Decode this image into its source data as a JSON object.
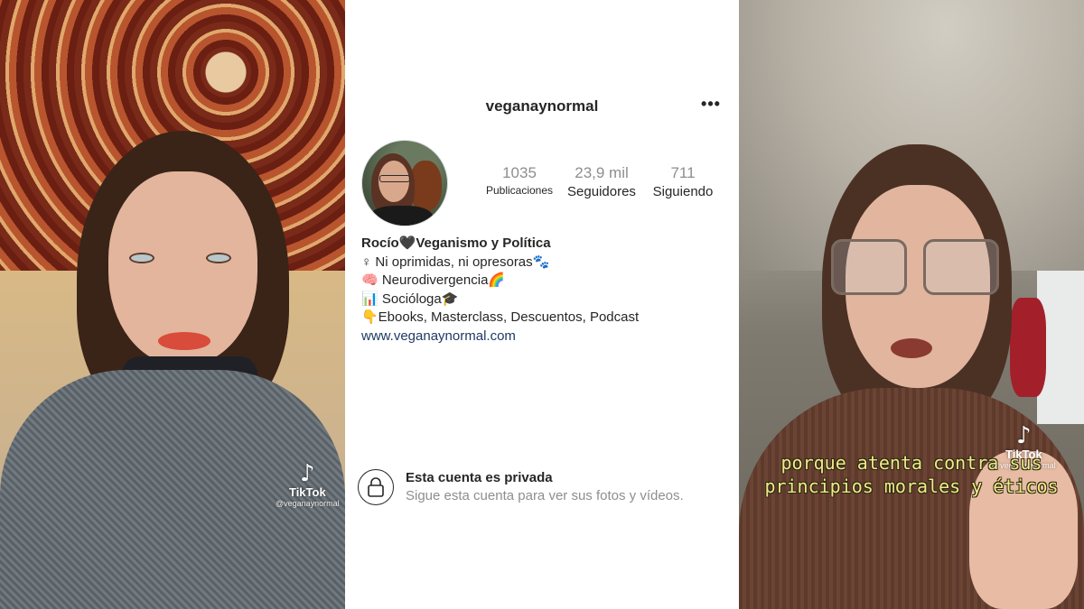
{
  "left_video": {
    "watermark_brand": "TikTok",
    "watermark_handle": "@veganaynormal",
    "watermark_icon": "tiktok-note-icon"
  },
  "profile": {
    "username": "veganaynormal",
    "more_icon": "more-options-icon",
    "stats": [
      {
        "value": "1035",
        "label": "Publicaciones"
      },
      {
        "value": "23,9 mil",
        "label": "Seguidores"
      },
      {
        "value": "711",
        "label": "Siguiendo"
      }
    ],
    "bio": {
      "name": "Rocío🖤Veganismo y Política",
      "lines": [
        "♀ Ni oprimidas, ni opresoras🐾",
        "🧠 Neurodivergencia🌈",
        "📊 Socióloga🎓",
        "👇Ebooks, Masterclass, Descuentos, Podcast"
      ],
      "link": "www.veganaynormal.com"
    },
    "private": {
      "icon": "lock-icon",
      "title": "Esta cuenta es privada",
      "subtitle": "Sigue esta cuenta para ver sus fotos y vídeos."
    },
    "colors": {
      "text": "#262626",
      "muted": "#8e8e8e",
      "link": "#1e3a64"
    }
  },
  "right_video": {
    "watermark_brand": "TikTok",
    "watermark_handle": "@veganaynormal",
    "caption_line1": "porque atenta contra sus",
    "caption_line2": "principios morales y éticos",
    "caption_color": "#f3e88a"
  }
}
